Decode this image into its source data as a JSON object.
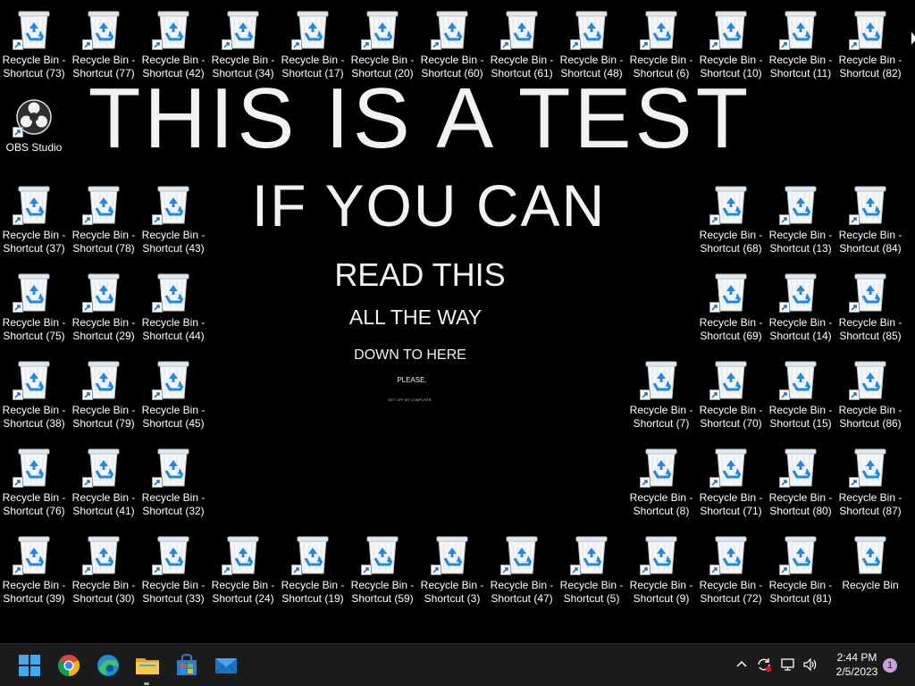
{
  "wallpaper": {
    "line1": "THIS IS A TEST",
    "line2": "IF YOU CAN",
    "line3": "READ THIS",
    "line4": "ALL THE WAY",
    "line5": "DOWN TO HERE",
    "line6": "PLEASE.",
    "line7": "GET OFF MY COMPUTER."
  },
  "desktop": {
    "icons": [
      {
        "label": "Recycle Bin - Shortcut (73)",
        "kind": "recycle-bin-shortcut"
      },
      {
        "label": "Recycle Bin - Shortcut (77)",
        "kind": "recycle-bin-shortcut"
      },
      {
        "label": "Recycle Bin - Shortcut (42)",
        "kind": "recycle-bin-shortcut"
      },
      {
        "label": "Recycle Bin - Shortcut (34)",
        "kind": "recycle-bin-shortcut"
      },
      {
        "label": "Recycle Bin - Shortcut (17)",
        "kind": "recycle-bin-shortcut"
      },
      {
        "label": "Recycle Bin - Shortcut (20)",
        "kind": "recycle-bin-shortcut"
      },
      {
        "label": "Recycle Bin - Shortcut (60)",
        "kind": "recycle-bin-shortcut"
      },
      {
        "label": "Recycle Bin - Shortcut (61)",
        "kind": "recycle-bin-shortcut"
      },
      {
        "label": "Recycle Bin - Shortcut (48)",
        "kind": "recycle-bin-shortcut"
      },
      {
        "label": "Recycle Bin - Shortcut (6)",
        "kind": "recycle-bin-shortcut"
      },
      {
        "label": "Recycle Bin - Shortcut (10)",
        "kind": "recycle-bin-shortcut"
      },
      {
        "label": "Recycle Bin - Shortcut (11)",
        "kind": "recycle-bin-shortcut"
      },
      {
        "label": "Recycle Bin - Shortcut (82)",
        "kind": "recycle-bin-shortcut"
      },
      {
        "label": "OBS Studio",
        "kind": "obs-shortcut"
      },
      {
        "label": "Recycle Bin - Shortcut (37)",
        "kind": "recycle-bin-shortcut"
      },
      {
        "label": "Recycle Bin - Shortcut (78)",
        "kind": "recycle-bin-shortcut"
      },
      {
        "label": "Recycle Bin - Shortcut (43)",
        "kind": "recycle-bin-shortcut"
      },
      {
        "label": "Recycle Bin - Shortcut (68)",
        "kind": "recycle-bin-shortcut"
      },
      {
        "label": "Recycle Bin - Shortcut (13)",
        "kind": "recycle-bin-shortcut"
      },
      {
        "label": "Recycle Bin - Shortcut (84)",
        "kind": "recycle-bin-shortcut"
      },
      {
        "label": "Recycle Bin - Shortcut (75)",
        "kind": "recycle-bin-shortcut"
      },
      {
        "label": "Recycle Bin - Shortcut (29)",
        "kind": "recycle-bin-shortcut"
      },
      {
        "label": "Recycle Bin - Shortcut (44)",
        "kind": "recycle-bin-shortcut"
      },
      {
        "label": "Recycle Bin - Shortcut (69)",
        "kind": "recycle-bin-shortcut"
      },
      {
        "label": "Recycle Bin - Shortcut (14)",
        "kind": "recycle-bin-shortcut"
      },
      {
        "label": "Recycle Bin - Shortcut (85)",
        "kind": "recycle-bin-shortcut"
      },
      {
        "label": "Recycle Bin - Shortcut (38)",
        "kind": "recycle-bin-shortcut"
      },
      {
        "label": "Recycle Bin - Shortcut (79)",
        "kind": "recycle-bin-shortcut"
      },
      {
        "label": "Recycle Bin - Shortcut (45)",
        "kind": "recycle-bin-shortcut"
      },
      {
        "label": "Recycle Bin - Shortcut (7)",
        "kind": "recycle-bin-shortcut"
      },
      {
        "label": "Recycle Bin - Shortcut (70)",
        "kind": "recycle-bin-shortcut"
      },
      {
        "label": "Recycle Bin - Shortcut (15)",
        "kind": "recycle-bin-shortcut"
      },
      {
        "label": "Recycle Bin - Shortcut (86)",
        "kind": "recycle-bin-shortcut"
      },
      {
        "label": "Recycle Bin - Shortcut (76)",
        "kind": "recycle-bin-shortcut"
      },
      {
        "label": "Recycle Bin - Shortcut (41)",
        "kind": "recycle-bin-shortcut"
      },
      {
        "label": "Recycle Bin - Shortcut (32)",
        "kind": "recycle-bin-shortcut"
      },
      {
        "label": "Recycle Bin - Shortcut (8)",
        "kind": "recycle-bin-shortcut"
      },
      {
        "label": "Recycle Bin - Shortcut (71)",
        "kind": "recycle-bin-shortcut"
      },
      {
        "label": "Recycle Bin - Shortcut (80)",
        "kind": "recycle-bin-shortcut"
      },
      {
        "label": "Recycle Bin - Shortcut (87)",
        "kind": "recycle-bin-shortcut"
      },
      {
        "label": "Recycle Bin - Shortcut (39)",
        "kind": "recycle-bin-shortcut"
      },
      {
        "label": "Recycle Bin - Shortcut (30)",
        "kind": "recycle-bin-shortcut"
      },
      {
        "label": "Recycle Bin - Shortcut (33)",
        "kind": "recycle-bin-shortcut"
      },
      {
        "label": "Recycle Bin - Shortcut (24)",
        "kind": "recycle-bin-shortcut"
      },
      {
        "label": "Recycle Bin - Shortcut (19)",
        "kind": "recycle-bin-shortcut"
      },
      {
        "label": "Recycle Bin - Shortcut (59)",
        "kind": "recycle-bin-shortcut"
      },
      {
        "label": "Recycle Bin - Shortcut (3)",
        "kind": "recycle-bin-shortcut"
      },
      {
        "label": "Recycle Bin - Shortcut (47)",
        "kind": "recycle-bin-shortcut"
      },
      {
        "label": "Recycle Bin - Shortcut (5)",
        "kind": "recycle-bin-shortcut"
      },
      {
        "label": "Recycle Bin - Shortcut (9)",
        "kind": "recycle-bin-shortcut"
      },
      {
        "label": "Recycle Bin - Shortcut (72)",
        "kind": "recycle-bin-shortcut"
      },
      {
        "label": "Recycle Bin - Shortcut (81)",
        "kind": "recycle-bin-shortcut"
      },
      {
        "label": "Recycle Bin",
        "kind": "recycle-bin"
      }
    ]
  },
  "taskbar": {
    "pinned": [
      {
        "name": "start-button",
        "icon": "windows-logo-icon"
      },
      {
        "name": "chrome-button",
        "icon": "chrome-icon"
      },
      {
        "name": "edge-button",
        "icon": "edge-icon"
      },
      {
        "name": "file-explorer-button",
        "icon": "folder-icon"
      },
      {
        "name": "microsoft-store-button",
        "icon": "store-icon"
      },
      {
        "name": "mail-button",
        "icon": "mail-icon"
      }
    ],
    "tray": {
      "icons": [
        "chevron-up-icon",
        "sync-alert-icon",
        "network-icon",
        "volume-icon"
      ]
    },
    "clock": {
      "time": "2:44 PM",
      "date": "2/5/2023"
    },
    "notification_count": "1"
  },
  "colors": {
    "desktop_bg": "#000000",
    "taskbar_bg": "#1b1b1b",
    "recycle_blue": "#1e88e5",
    "notification_badge": "#c8a0e0"
  }
}
